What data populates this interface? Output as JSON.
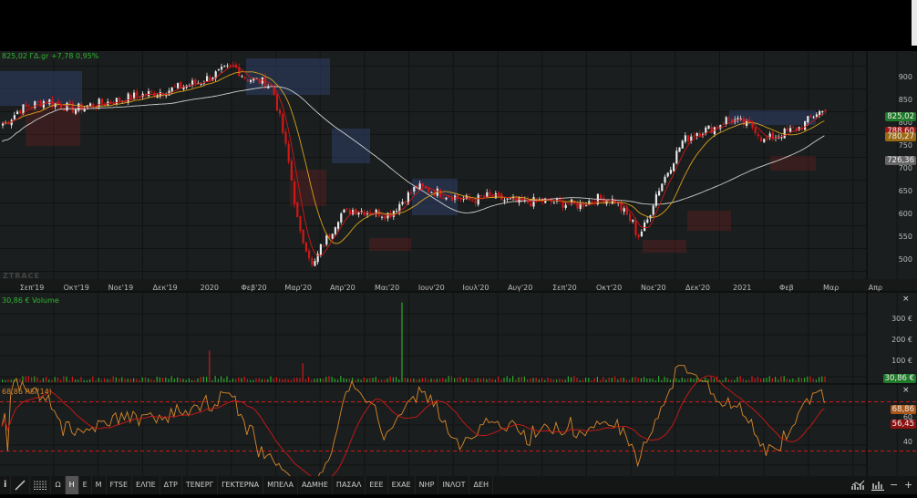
{
  "header": {
    "price_label": "825,02 ΓΔ.gr +7,78 0,95%",
    "watermark": "ZTRACE"
  },
  "price_axis": [
    "900",
    "850",
    "800",
    "750",
    "700",
    "650",
    "600",
    "550",
    "500"
  ],
  "price_tags": {
    "last": "825,02",
    "ma_short": "788,60",
    "ma_mid": "780,27",
    "ma_long": "726,36"
  },
  "months": [
    "Σεπ'19",
    "Οκτ'19",
    "Νοε'19",
    "Δεκ'19",
    "2020",
    "Φεβ'20",
    "Μαρ'20",
    "Απρ'20",
    "Μαι'20",
    "Ιουν'20",
    "Ιουλ'20",
    "Αυγ'20",
    "Σεπ'20",
    "Οκτ'20",
    "Νοε'20",
    "Δεκ'20",
    "2021",
    "Φεβ",
    "Μαρ",
    "Απρ"
  ],
  "volume": {
    "label": "30,86 € Volume",
    "axis": [
      "300 €",
      "200 €",
      "100 €"
    ],
    "tag": "30,86 €"
  },
  "rsi": {
    "label": "68,86 RSI(14)",
    "axis": [
      "60",
      "40"
    ],
    "tag_value": "68,86",
    "tag_signal": "56,45"
  },
  "toolbar": {
    "symbols": [
      "Ω",
      "Η",
      "Ε",
      "Μ",
      "FTSE",
      "ΕΛΠΕ",
      "ΔΤΡ",
      "ΤΕΝΕΡΓ",
      "ΓΕΚΤΕΡΝΑ",
      "ΜΠΕΛΑ",
      "ΑΔΜΗΕ",
      "ΠΑΣΑΛ",
      "ΕΕΕ",
      "ΕΧΑΕ",
      "ΝΗΡ",
      "ΙΝΛΟΤ",
      "ΔΕΗ"
    ],
    "active": "Η",
    "right_minus": "−",
    "right_plus": "+"
  },
  "colors": {
    "up": "#e8e8e8",
    "down": "#d01818",
    "ma_short": "#d01818",
    "ma_mid": "#d9a21c",
    "ma_long": "#cfcfcf",
    "green": "#2aa82a",
    "rsi": "#d9882a"
  },
  "chart_data": {
    "type": "candlestick",
    "title": "825,02 ΓΔ.gr +7,78 0,95%",
    "ylim": [
      470,
      950
    ],
    "x_unit": "months since Σεπ'19",
    "price_keypoints": [
      [
        -0.61,
        800
      ],
      [
        -0.3,
        830
      ],
      [
        0.3,
        850
      ],
      [
        0.91,
        830
      ],
      [
        1.32,
        840
      ],
      [
        1.93,
        850
      ],
      [
        2.34,
        860
      ],
      [
        2.95,
        870
      ],
      [
        3.35,
        880
      ],
      [
        3.76,
        890
      ],
      [
        4.17,
        910
      ],
      [
        4.53,
        925
      ],
      [
        4.78,
        900
      ],
      [
        5.18,
        890
      ],
      [
        5.39,
        880
      ],
      [
        5.59,
        800
      ],
      [
        5.79,
        700
      ],
      [
        6.0,
        560
      ],
      [
        6.2,
        520
      ],
      [
        6.3,
        480
      ],
      [
        6.5,
        530
      ],
      [
        6.71,
        560
      ],
      [
        6.91,
        600
      ],
      [
        7.22,
        610
      ],
      [
        7.62,
        605
      ],
      [
        8.03,
        600
      ],
      [
        8.43,
        640
      ],
      [
        8.64,
        660
      ],
      [
        9.04,
        650
      ],
      [
        9.45,
        640
      ],
      [
        9.86,
        630
      ],
      [
        10.26,
        640
      ],
      [
        10.67,
        630
      ],
      [
        11.08,
        625
      ],
      [
        11.48,
        630
      ],
      [
        11.89,
        625
      ],
      [
        12.3,
        620
      ],
      [
        12.7,
        635
      ],
      [
        13.11,
        630
      ],
      [
        13.52,
        580
      ],
      [
        13.62,
        550
      ],
      [
        13.82,
        580
      ],
      [
        14.02,
        640
      ],
      [
        14.33,
        700
      ],
      [
        14.63,
        760
      ],
      [
        14.94,
        780
      ],
      [
        15.35,
        790
      ],
      [
        15.65,
        810
      ],
      [
        15.96,
        800
      ],
      [
        16.26,
        790
      ],
      [
        16.46,
        760
      ],
      [
        16.67,
        770
      ],
      [
        16.97,
        780
      ],
      [
        17.28,
        790
      ],
      [
        17.68,
        825
      ]
    ],
    "volume_spikes": [
      [
        4.0,
        150
      ],
      [
        6.1,
        90
      ],
      [
        8.3,
        380
      ]
    ],
    "rsi_levels": [
      70,
      30
    ]
  }
}
